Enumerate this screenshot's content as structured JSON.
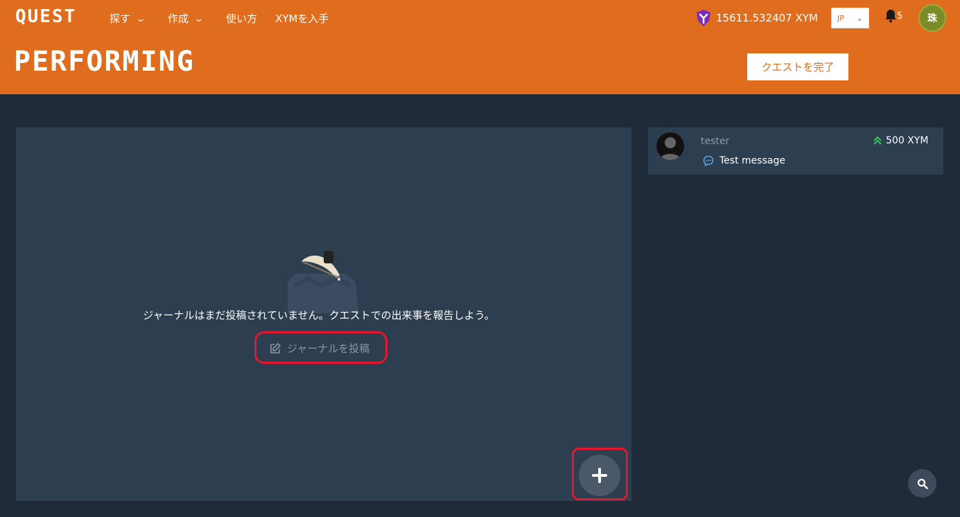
{
  "header": {
    "logo": "QUEST",
    "nav": [
      {
        "label": "探す",
        "has_dropdown": true
      },
      {
        "label": "作成",
        "has_dropdown": true
      },
      {
        "label": "使い方",
        "has_dropdown": false
      },
      {
        "label": "XYMを入手",
        "has_dropdown": false
      }
    ],
    "balance": "15611.532407 XYM",
    "language": "JP",
    "notification_count": "5",
    "avatar_text": "珠"
  },
  "page": {
    "title": "PERFORMING",
    "complete_button": "クエストを完了"
  },
  "journal": {
    "empty_message": "ジャーナルはまだ投稿されていません。クエストでの出来事を報告しよう。",
    "post_link": "ジャーナルを投稿"
  },
  "sidebar": {
    "user": "tester",
    "amount": "500 XYM",
    "message": "Test message"
  },
  "colors": {
    "header_bg": "#e06d1e",
    "page_bg": "#1f2b39",
    "panel_bg": "#2c3e50",
    "highlight": "#e8162a",
    "accent_green": "#3fbf5a",
    "symbol_purple": "#7b2cbf"
  }
}
